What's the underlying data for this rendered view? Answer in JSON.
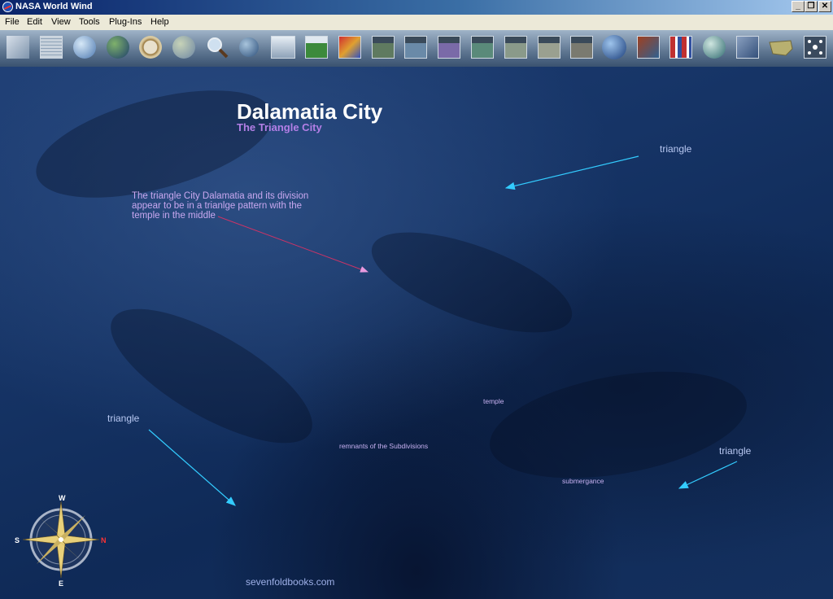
{
  "window": {
    "title": "NASA World Wind"
  },
  "menu": {
    "items": [
      "File",
      "Edit",
      "View",
      "Tools",
      "Plug-Ins",
      "Help"
    ]
  },
  "toolbar": {
    "buttons": [
      "layers-icon",
      "grid-icon",
      "globe-grid-icon",
      "blue-marble-icon",
      "compass-icon",
      "world-icon",
      "search-icon",
      "earth-small-icon",
      "scale-bar-icon",
      "wms-icon",
      "weather-icon",
      "landsat-icon",
      "modis-icon",
      "terra-icon",
      "aqua-icon",
      "usgs-topo-icon",
      "usgs-urban-icon",
      "usgs-ortho-icon",
      "moon-icon",
      "sar-icon",
      "flags-icon",
      "landmark-icon",
      "place-names-icon",
      "us-map-icon",
      "plugin-icon"
    ]
  },
  "map": {
    "title": "Dalamatia City",
    "subtitle": "The Triangle City",
    "note": "The triangle City Dalamatia and its division appear to be in a trianlge pattern with the temple in the middle",
    "labels": {
      "triangle_top_right": "triangle",
      "triangle_left": "triangle",
      "triangle_bottom_right": "triangle",
      "temple": "temple",
      "subdivisions": "remnants of the Subdivisions",
      "submergance": "submergance"
    },
    "footer": "sevenfoldbooks.com",
    "compass": {
      "north": "N",
      "south": "S",
      "east": "E",
      "west": "W"
    }
  },
  "colors": {
    "arrow": "#33ccff",
    "note_arrow": "#cc3366",
    "title_text": "#ffffff",
    "subtitle_text": "#b37fe6"
  }
}
